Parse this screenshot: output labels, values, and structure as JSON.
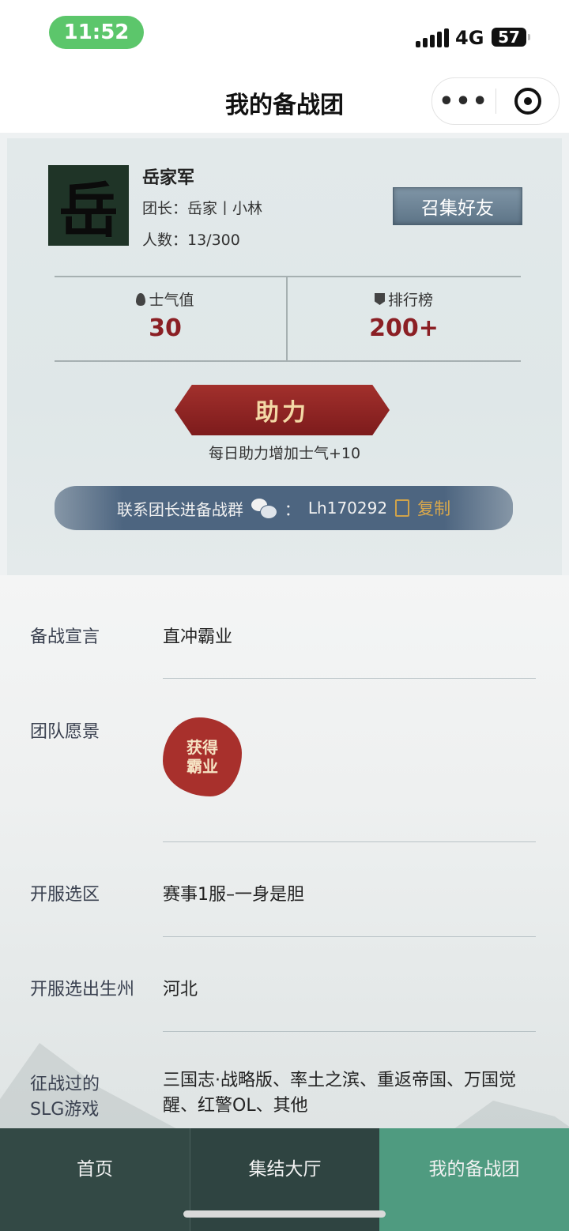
{
  "status_bar": {
    "time": "11:52",
    "network": "4G",
    "battery": "57"
  },
  "nav": {
    "title": "我的备战团",
    "more": "•••"
  },
  "team": {
    "logo_char": "岳",
    "name": "岳家军",
    "leader": "团长：岳家丨小林",
    "members": "人数：13/300",
    "summon_button": "召集好友",
    "morale_label": "士气值",
    "morale_value": "30",
    "rank_label": "排行榜",
    "rank_value": "200+",
    "assist_button": "助力",
    "assist_hint": "每日助力增加士气+10",
    "contact_text": "联系团长进备战群",
    "contact_sep": "：",
    "contact_id": "Lh170292",
    "copy_label": "复制"
  },
  "details": {
    "declaration_label": "备战宣言",
    "declaration_value": "直冲霸业",
    "vision_label": "团队愿景",
    "vision_seal": [
      "获得",
      "霸业"
    ],
    "zone_label": "开服选区",
    "zone_value": "赛事1服–一身是胆",
    "state_label": "开服选出生州",
    "state_value": "河北",
    "games_label_1": "征战过的",
    "games_label_2": "SLG游戏",
    "games_value": "三国志·战略版、率土之滨、重返帝国、万国觉醒、红警OL、其他"
  },
  "tabs": [
    "首页",
    "集结大厅",
    "我的备战团"
  ],
  "colors": {
    "accent_red": "#8b1f24",
    "active_tab": "#4f9b80",
    "tab_bg": "#334945"
  }
}
